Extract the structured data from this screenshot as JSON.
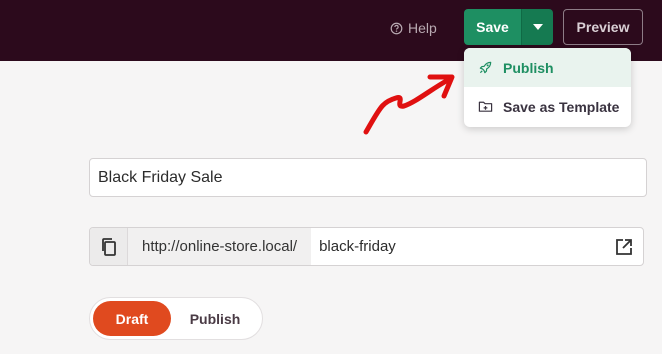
{
  "header": {
    "help_label": "Help",
    "save_label": "Save",
    "preview_label": "Preview"
  },
  "save_menu": {
    "items": [
      {
        "label": "Publish",
        "icon": "rocket-icon"
      },
      {
        "label": "Save as Template",
        "icon": "folder-plus-icon"
      }
    ]
  },
  "form": {
    "title_value": "Black Friday Sale",
    "url_prefix": "http://online-store.local/",
    "slug_value": "black-friday"
  },
  "status_toggle": {
    "draft_label": "Draft",
    "publish_label": "Publish",
    "selected": "Draft"
  },
  "colors": {
    "topbar": "#2c0a1c",
    "save_green": "#1e8f62",
    "draft_orange": "#e04a1f",
    "annotation_red": "#e01010"
  }
}
